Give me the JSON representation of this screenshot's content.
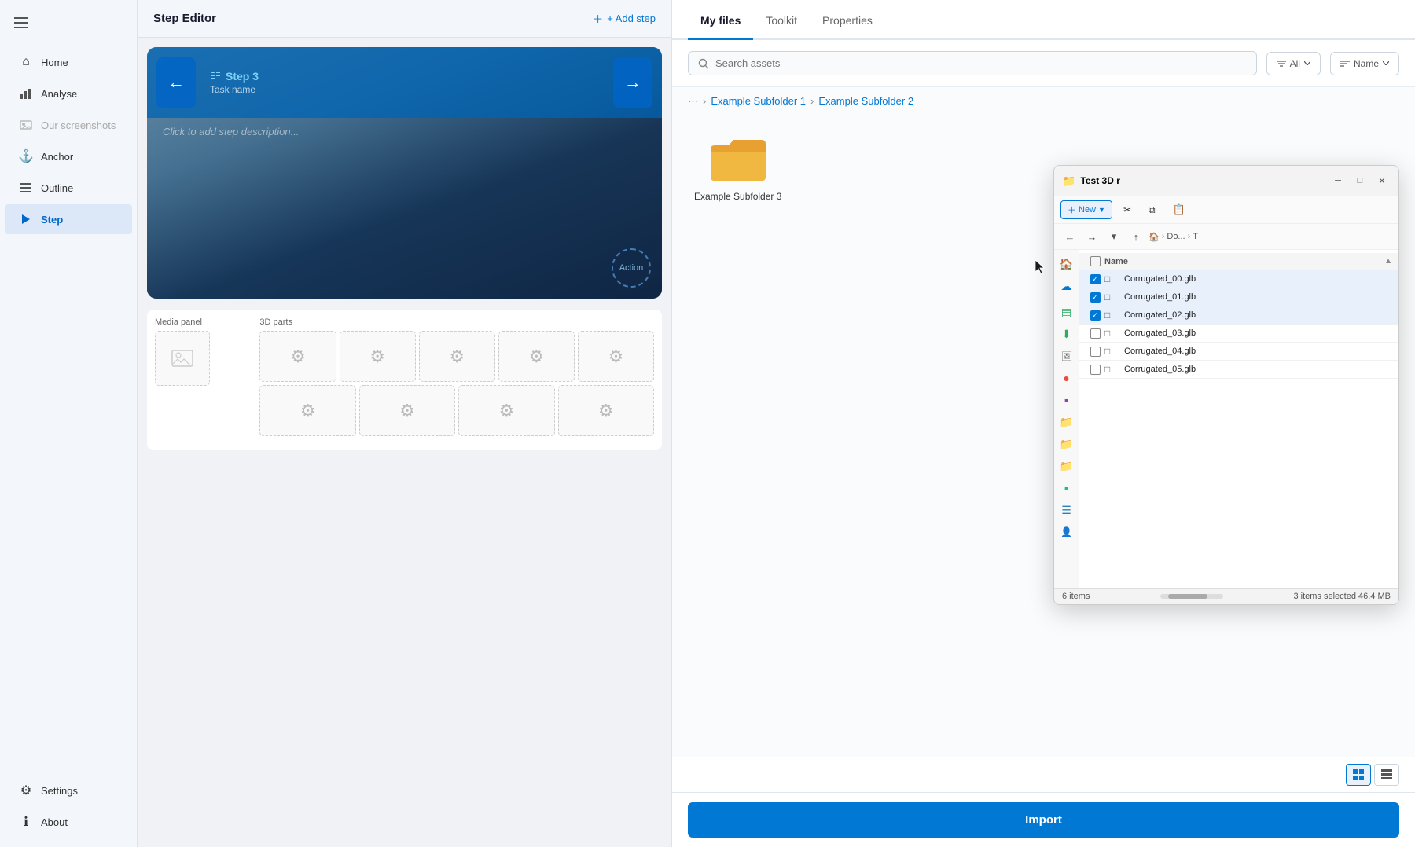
{
  "sidebar": {
    "items": [
      {
        "id": "home",
        "label": "Home",
        "icon": "⌂",
        "active": false
      },
      {
        "id": "analyse",
        "label": "Analyse",
        "icon": "📊",
        "active": false
      },
      {
        "id": "our-screenshots",
        "label": "Our screenshots",
        "icon": "🖼",
        "active": false,
        "disabled": true
      },
      {
        "id": "anchor",
        "label": "Anchor",
        "icon": "⚓",
        "active": false
      },
      {
        "id": "outline",
        "label": "Outline",
        "icon": "☰",
        "active": false
      },
      {
        "id": "step",
        "label": "Step",
        "icon": "▶",
        "active": true
      }
    ],
    "bottom_items": [
      {
        "id": "settings",
        "label": "Settings",
        "icon": "⚙"
      },
      {
        "id": "about",
        "label": "About",
        "icon": "ℹ"
      }
    ]
  },
  "step_editor": {
    "title": "Step Editor",
    "add_step_label": "+ Add step",
    "step": {
      "number": "Step 3",
      "task_label": "Task name",
      "description_placeholder": "Click to add step description...",
      "action_label": "Action"
    },
    "media_panel": {
      "label": "Media panel"
    },
    "parts_panel": {
      "label": "3D parts"
    }
  },
  "asset_panel": {
    "tabs": [
      {
        "id": "my-files",
        "label": "My files",
        "active": true
      },
      {
        "id": "toolkit",
        "label": "Toolkit",
        "active": false
      },
      {
        "id": "properties",
        "label": "Properties",
        "active": false
      }
    ],
    "search": {
      "placeholder": "Search assets",
      "filter_label": "All",
      "sort_label": "Name"
    },
    "breadcrumb": {
      "dots": "···",
      "items": [
        "Example Subfolder 1",
        "Example Subfolder 2"
      ]
    },
    "folder": {
      "name": "Example Subfolder 3"
    },
    "import_label": "Import",
    "view_grid_label": "Grid view",
    "view_list_label": "List view"
  },
  "explorer": {
    "title": "Test 3D r",
    "new_label": "New",
    "path": [
      "Do...",
      "T"
    ],
    "file_header": "Name",
    "files": [
      {
        "name": "Corrugated_00.glb",
        "checked": true
      },
      {
        "name": "Corrugated_01.glb",
        "checked": true
      },
      {
        "name": "Corrugated_02.glb",
        "checked": true
      },
      {
        "name": "Corrugated_03.glb",
        "checked": false
      },
      {
        "name": "Corrugated_04.glb",
        "checked": false
      },
      {
        "name": "Corrugated_05.glb",
        "checked": false
      }
    ],
    "status_items": "6 items",
    "status_selected": "3 items selected",
    "status_size": "46.4 MB"
  },
  "colors": {
    "accent": "#0078d4",
    "active_nav": "#dce8f8",
    "folder_yellow": "#e8a030",
    "step_blue": "#1e88e5"
  }
}
